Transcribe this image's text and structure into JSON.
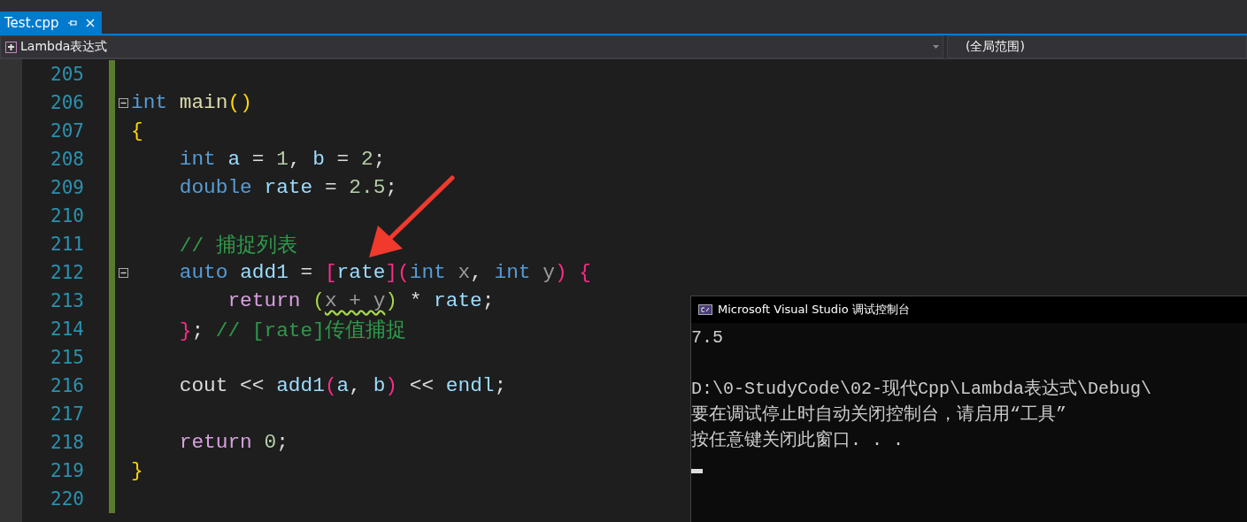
{
  "tabs": [
    {
      "label": "Test.cpp",
      "selected": true
    }
  ],
  "navigation_bar": {
    "scope_dropdown": "Lambda表达式",
    "member_dropdown": "(全局范围)"
  },
  "editor": {
    "lines": [
      {
        "number": "205",
        "collapse_box": false
      },
      {
        "number": "206",
        "collapse_box": true,
        "tokens": [
          {
            "t": "int",
            "kind": "keyword"
          },
          {
            "t": " main",
            "kind": "function"
          },
          {
            "t": "()",
            "kind": "paren"
          }
        ]
      },
      {
        "number": "207",
        "collapse_box": false,
        "tokens": [
          {
            "t": "{",
            "kind": "paren"
          }
        ]
      },
      {
        "number": "208",
        "collapse_box": false,
        "tokens": [
          {
            "t": "    int",
            "kind": "keyword"
          },
          {
            "t": " a",
            "kind": "variable"
          },
          {
            "t": " = "
          },
          {
            "t": "1",
            "kind": "number"
          },
          {
            "t": ", "
          },
          {
            "t": "b",
            "kind": "variable"
          },
          {
            "t": " = "
          },
          {
            "t": "2",
            "kind": "number"
          },
          {
            "t": ";"
          }
        ]
      },
      {
        "number": "209",
        "collapse_box": false,
        "tokens": [
          {
            "t": "    double",
            "kind": "keyword"
          },
          {
            "t": " rate",
            "kind": "variable"
          },
          {
            "t": " = "
          },
          {
            "t": "2.5",
            "kind": "number"
          },
          {
            "t": ";"
          }
        ]
      },
      {
        "number": "210",
        "collapse_box": false
      },
      {
        "number": "211",
        "collapse_box": false,
        "tokens": [
          {
            "t": "    // 捕捉列表",
            "kind": "comment"
          }
        ]
      },
      {
        "number": "212",
        "collapse_box": true,
        "tokens": [
          {
            "t": "    auto",
            "kind": "keyword"
          },
          {
            "t": " add1",
            "kind": "variable"
          },
          {
            "t": " = "
          },
          {
            "t": "[",
            "kind": "bracket"
          },
          {
            "t": "rate",
            "kind": "variable"
          },
          {
            "t": "](",
            "kind": "bracket"
          },
          {
            "t": "int",
            "kind": "keyword"
          },
          {
            "t": " x",
            "kind": "parameter"
          },
          {
            "t": ", "
          },
          {
            "t": "int",
            "kind": "keyword"
          },
          {
            "t": " y",
            "kind": "parameter"
          },
          {
            "t": ") {",
            "kind": "bracket"
          }
        ]
      },
      {
        "number": "213",
        "collapse_box": false,
        "tokens": [
          {
            "t": "        return",
            "kind": "control"
          },
          {
            "t": " (",
            "kind": "paren2"
          },
          {
            "t": "x + y",
            "kind": "squiggle"
          },
          {
            "t": ")",
            "kind": "paren2"
          },
          {
            "t": " * "
          },
          {
            "t": "rate",
            "kind": "variable"
          },
          {
            "t": ";"
          }
        ]
      },
      {
        "number": "214",
        "collapse_box": false,
        "tokens": [
          {
            "t": "    }",
            "kind": "bracket"
          },
          {
            "t": "; "
          },
          {
            "t": "// [rate]传值捕捉",
            "kind": "comment"
          }
        ]
      },
      {
        "number": "215",
        "collapse_box": false
      },
      {
        "number": "216",
        "collapse_box": false,
        "tokens": [
          {
            "t": "    cout << "
          },
          {
            "t": "add1",
            "kind": "variable"
          },
          {
            "t": "(",
            "kind": "bracket"
          },
          {
            "t": "a",
            "kind": "variable"
          },
          {
            "t": ", "
          },
          {
            "t": "b",
            "kind": "variable"
          },
          {
            "t": ")",
            "kind": "bracket"
          },
          {
            "t": " << "
          },
          {
            "t": "endl",
            "kind": "variable"
          },
          {
            "t": ";"
          }
        ]
      },
      {
        "number": "217",
        "collapse_box": false
      },
      {
        "number": "218",
        "collapse_box": false,
        "tokens": [
          {
            "t": "    return",
            "kind": "control"
          },
          {
            "t": " 0",
            "kind": "number"
          },
          {
            "t": ";"
          }
        ]
      },
      {
        "number": "219",
        "collapse_box": false,
        "tokens": [
          {
            "t": "}",
            "kind": "paren"
          }
        ]
      },
      {
        "number": "220",
        "collapse_box": false
      }
    ]
  },
  "console_window": {
    "title": "Microsoft Visual Studio 调试控制台",
    "output_lines": [
      "7.5",
      "D:\\0-StudyCode\\02-现代Cpp\\Lambda表达式\\Debug\\",
      "要在调试停止时自动关闭控制台，请启用“工具”",
      "按任意键关闭此窗口. . ."
    ]
  }
}
